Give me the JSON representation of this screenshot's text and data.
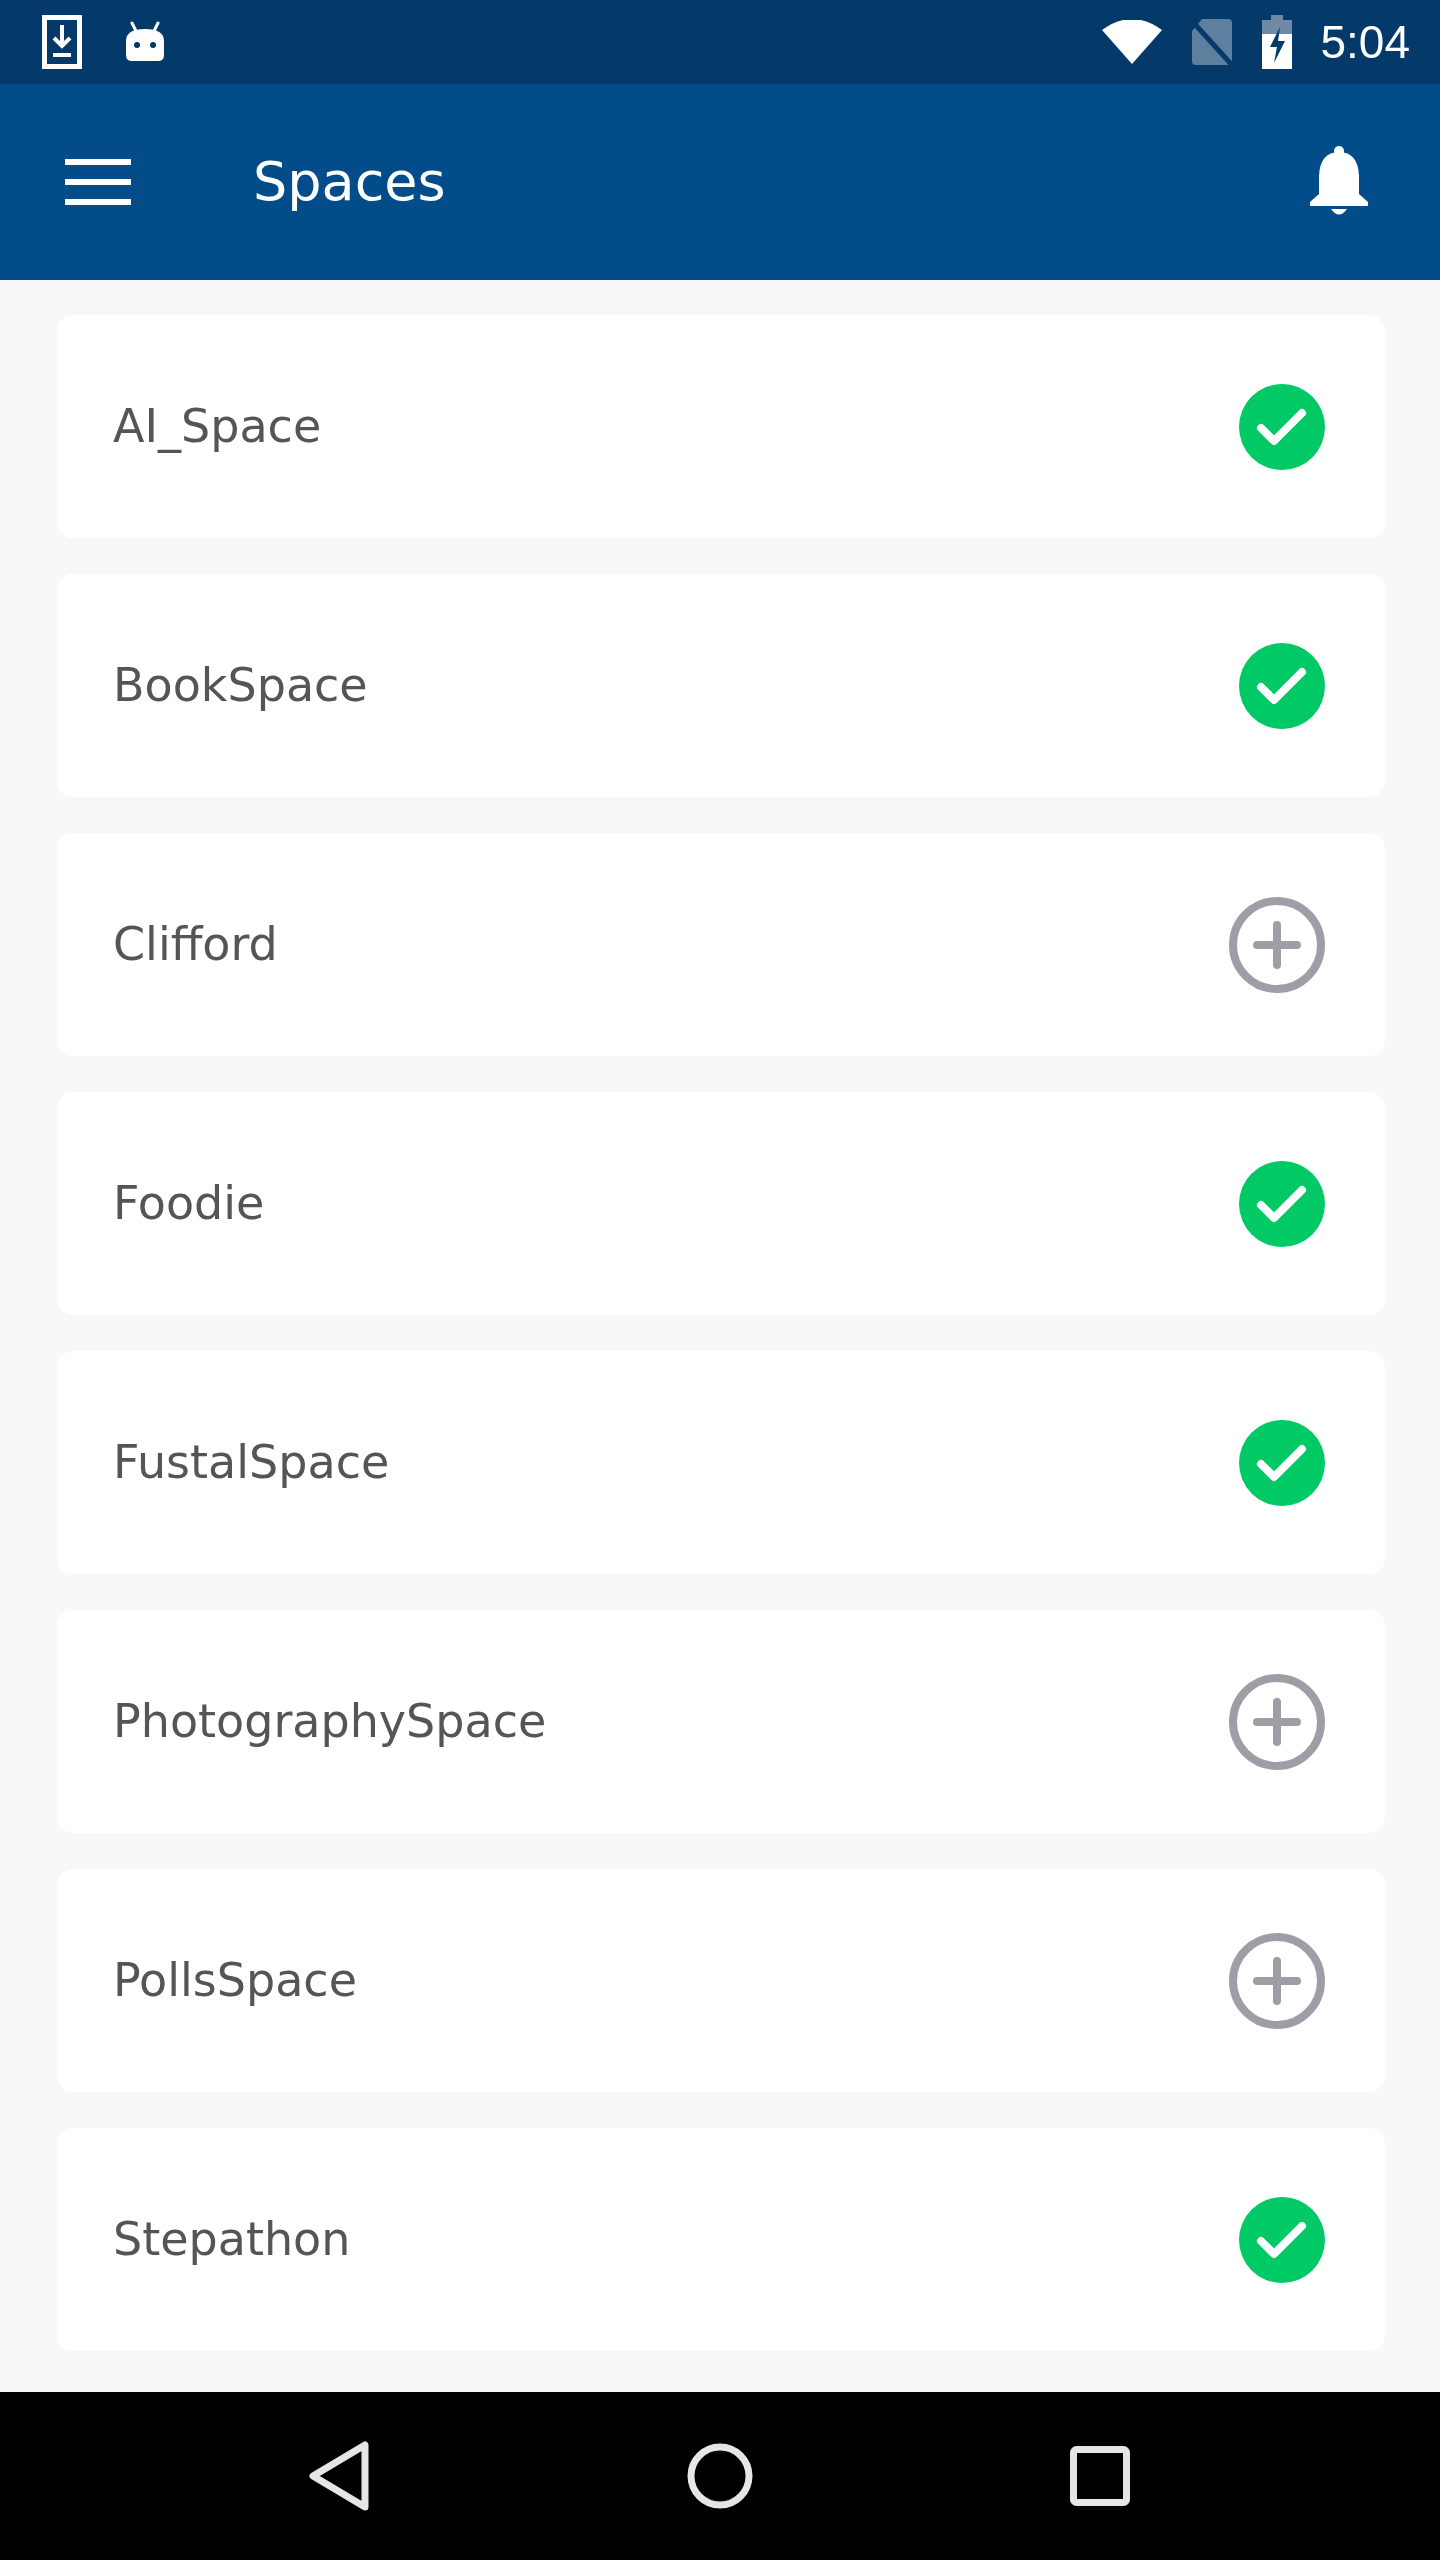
{
  "status_bar": {
    "time": "5:04"
  },
  "app_bar": {
    "title": "Spaces"
  },
  "spaces": [
    {
      "name": "AI_Space",
      "joined": true
    },
    {
      "name": "BookSpace",
      "joined": true
    },
    {
      "name": "Clifford",
      "joined": false
    },
    {
      "name": "Foodie",
      "joined": true
    },
    {
      "name": "FustalSpace",
      "joined": true
    },
    {
      "name": "PhotographySpace",
      "joined": false
    },
    {
      "name": "PollsSpace",
      "joined": false
    },
    {
      "name": "Stepathon",
      "joined": true
    }
  ]
}
